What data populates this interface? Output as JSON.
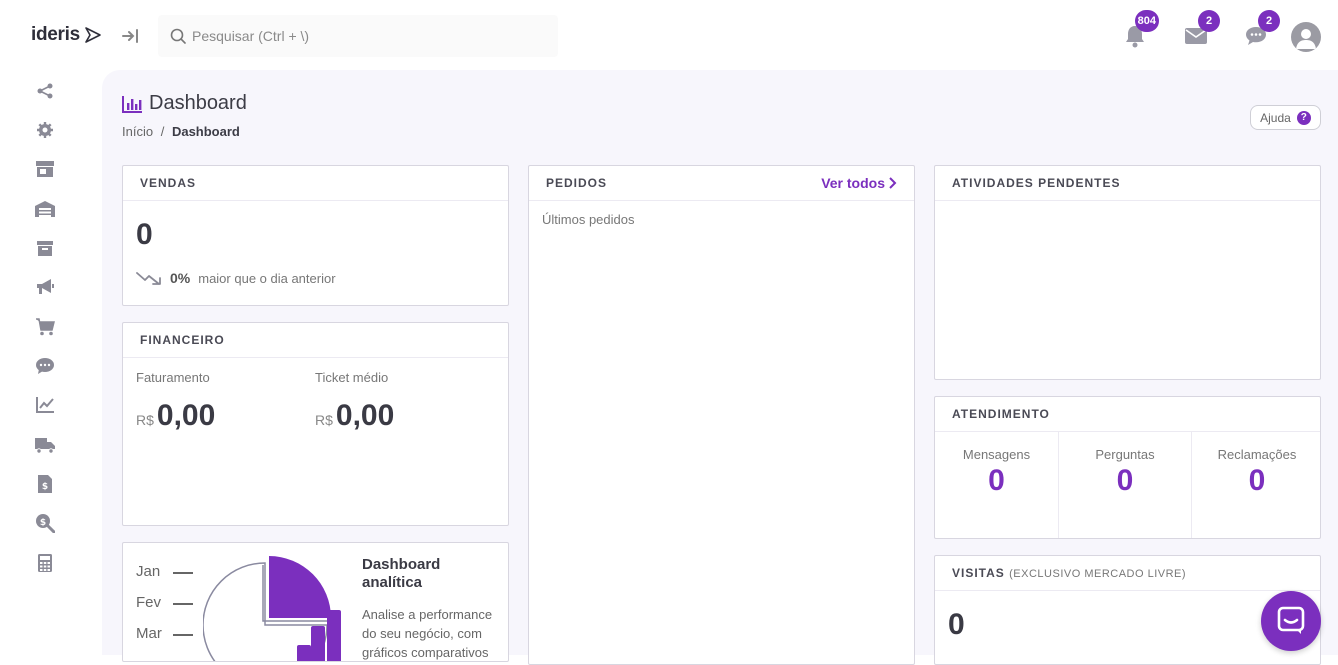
{
  "brand": {
    "name": "ideris"
  },
  "search": {
    "placeholder": "Pesquisar (Ctrl + \\)"
  },
  "notifications": {
    "bell_count": "804",
    "mail_count": "2",
    "chat_count": "2"
  },
  "sidebar": {
    "icons": [
      "share-icon",
      "gear-icon",
      "store-icon",
      "warehouse-icon",
      "archive-icon",
      "megaphone-icon",
      "cart-icon",
      "chat-icon",
      "chart-line-icon",
      "truck-icon",
      "invoice-icon",
      "money-search-icon",
      "calculator-icon"
    ]
  },
  "header": {
    "title": "Dashboard",
    "breadcrumb_home": "Início",
    "breadcrumb_sep": "/",
    "breadcrumb_current": "Dashboard",
    "help_label": "Ajuda",
    "help_q": "?"
  },
  "vendas": {
    "title": "VENDAS",
    "value": "0",
    "pct": "0%",
    "compare": "maior que o dia anterior"
  },
  "financeiro": {
    "title": "FINANCEIRO",
    "faturamento_label": "Faturamento",
    "faturamento_currency": "R$",
    "faturamento_value": "0,00",
    "ticket_label": "Ticket médio",
    "ticket_currency": "R$",
    "ticket_value": "0,00"
  },
  "analytics": {
    "months": [
      "Jan",
      "Fev",
      "Mar"
    ],
    "title_line1": "Dashboard",
    "title_line2": "analítica",
    "desc": "Analise a performance do seu negócio, com gráficos comparativos"
  },
  "pedidos": {
    "title": "PEDIDOS",
    "link": "Ver todos",
    "subtitle": "Últimos pedidos"
  },
  "atividades": {
    "title": "ATIVIDADES PENDENTES"
  },
  "atendimento": {
    "title": "ATENDIMENTO",
    "cols": [
      {
        "label": "Mensagens",
        "value": "0"
      },
      {
        "label": "Perguntas",
        "value": "0"
      },
      {
        "label": "Reclamações",
        "value": "0"
      }
    ]
  },
  "visitas": {
    "title": "VISITAS",
    "subtitle": "(EXCLUSIVO MERCADO LIVRE)",
    "value": "0"
  },
  "colors": {
    "accent": "#7b2fbe",
    "background": "#f7f6fc"
  }
}
